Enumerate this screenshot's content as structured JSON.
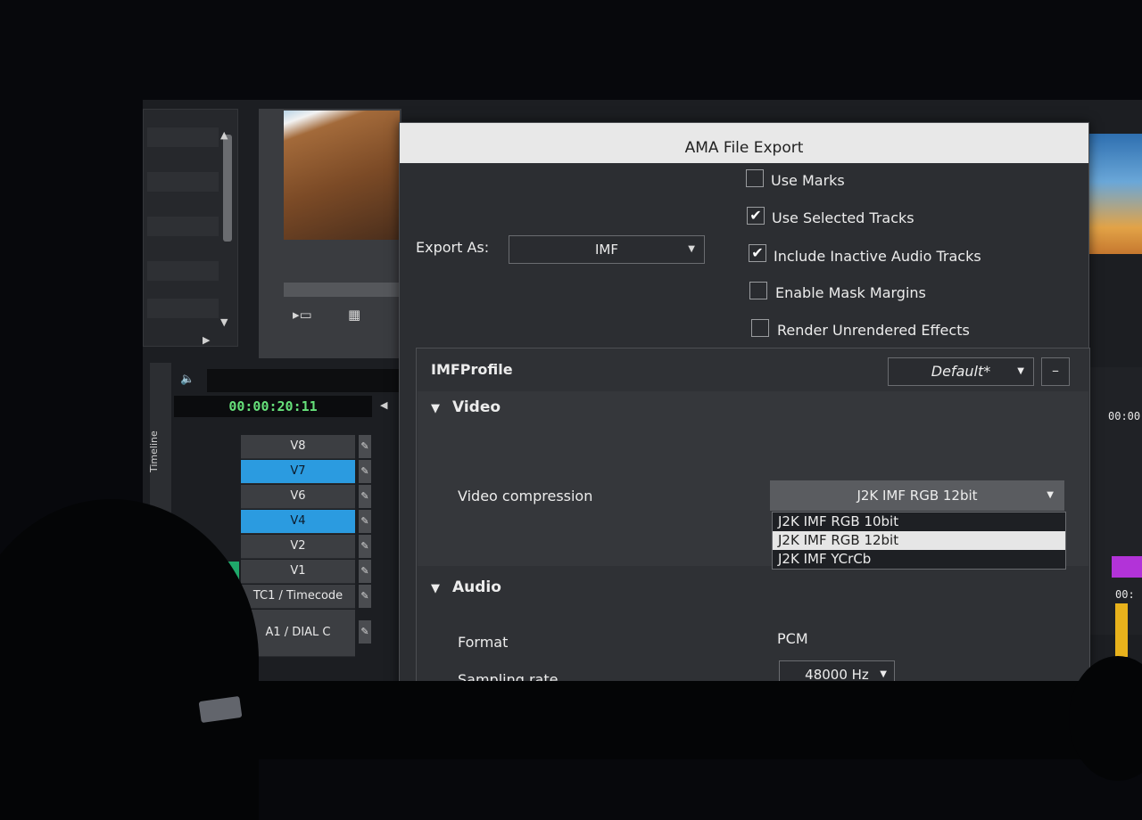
{
  "editor": {
    "timecode": "00:00:20:11",
    "timeline_side_label": "Timeline",
    "right_timecode": "00:00",
    "right_timecode_small": "00:",
    "tracks": [
      {
        "label": "V8",
        "selected": false
      },
      {
        "label": "V7",
        "selected": true
      },
      {
        "label": "V6",
        "selected": false
      },
      {
        "label": "V4",
        "selected": true
      },
      {
        "label": "V2",
        "selected": false
      },
      {
        "label": "V1",
        "selected": false
      },
      {
        "label": "TC1 / Timecode",
        "selected": false
      },
      {
        "label": "A1 / DIAL C",
        "selected": false
      }
    ],
    "colors": {
      "selected_track": "#2b9be0",
      "timecode_text": "#66e07a"
    }
  },
  "dialog": {
    "title": "AMA File Export",
    "export_as_label": "Export As:",
    "export_as_value": "IMF",
    "options": [
      {
        "label": "Use Marks",
        "checked": false
      },
      {
        "label": "Use Selected Tracks",
        "checked": true
      },
      {
        "label": "Include Inactive Audio Tracks",
        "checked": true
      },
      {
        "label": "Enable Mask Margins",
        "checked": false
      },
      {
        "label": "Render Unrendered Effects",
        "checked": false
      }
    ],
    "profile": {
      "title": "IMFProfile",
      "preset_value": "Default*",
      "minus_label": "–"
    },
    "video": {
      "header": "Video",
      "compression_label": "Video compression",
      "compression_value": "J2K IMF RGB 12bit",
      "compression_options": [
        "J2K IMF RGB 10bit",
        "J2K IMF RGB 12bit",
        "J2K IMF YCrCb"
      ],
      "highlighted_index": 1
    },
    "audio": {
      "header": "Audio",
      "format_label": "Format",
      "format_value": "PCM",
      "sampling_label": "Sampling rate",
      "sampling_value": "48000 Hz"
    }
  }
}
